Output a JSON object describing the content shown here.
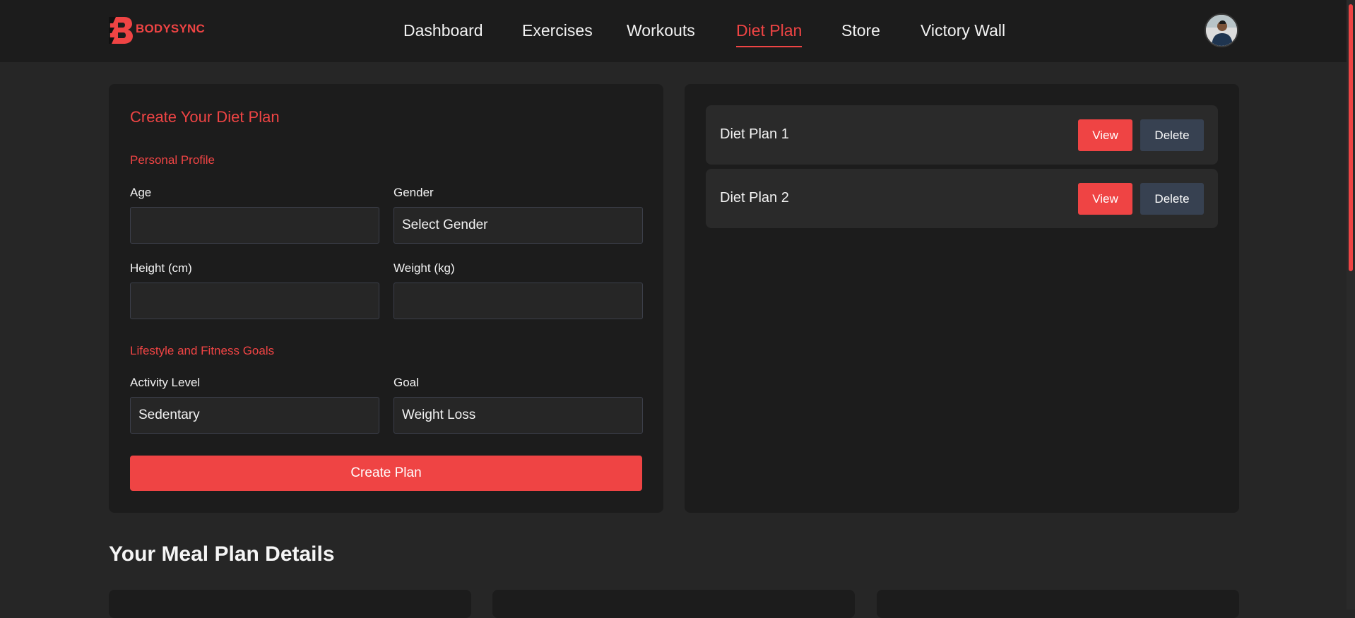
{
  "brand": {
    "name": "BODYSYNC"
  },
  "nav": {
    "items": [
      {
        "label": "Dashboard",
        "active": false
      },
      {
        "label": "Exercises",
        "active": false
      },
      {
        "label": "Workouts",
        "active": false
      },
      {
        "label": "Diet Plan",
        "active": true
      },
      {
        "label": "Store",
        "active": false
      },
      {
        "label": "Victory Wall",
        "active": false
      }
    ]
  },
  "colors": {
    "accent": "#ef4444",
    "background": "#262626",
    "surface": "#1c1c1c",
    "secondary_button": "#374151"
  },
  "form": {
    "title": "Create Your Diet Plan",
    "personal_section": "Personal Profile",
    "age_label": "Age",
    "age_value": "",
    "gender_label": "Gender",
    "gender_value": "Select Gender",
    "height_label": "Height (cm)",
    "height_value": "",
    "weight_label": "Weight (kg)",
    "weight_value": "",
    "lifestyle_section": "Lifestyle and Fitness Goals",
    "activity_label": "Activity Level",
    "activity_value": "Sedentary",
    "goal_label": "Goal",
    "goal_value": "Weight Loss",
    "submit_label": "Create Plan"
  },
  "plans": [
    {
      "name": "Diet Plan 1",
      "view_label": "View",
      "delete_label": "Delete"
    },
    {
      "name": "Diet Plan 2",
      "view_label": "View",
      "delete_label": "Delete"
    }
  ],
  "meal_section": {
    "title": "Your Meal Plan Details"
  }
}
